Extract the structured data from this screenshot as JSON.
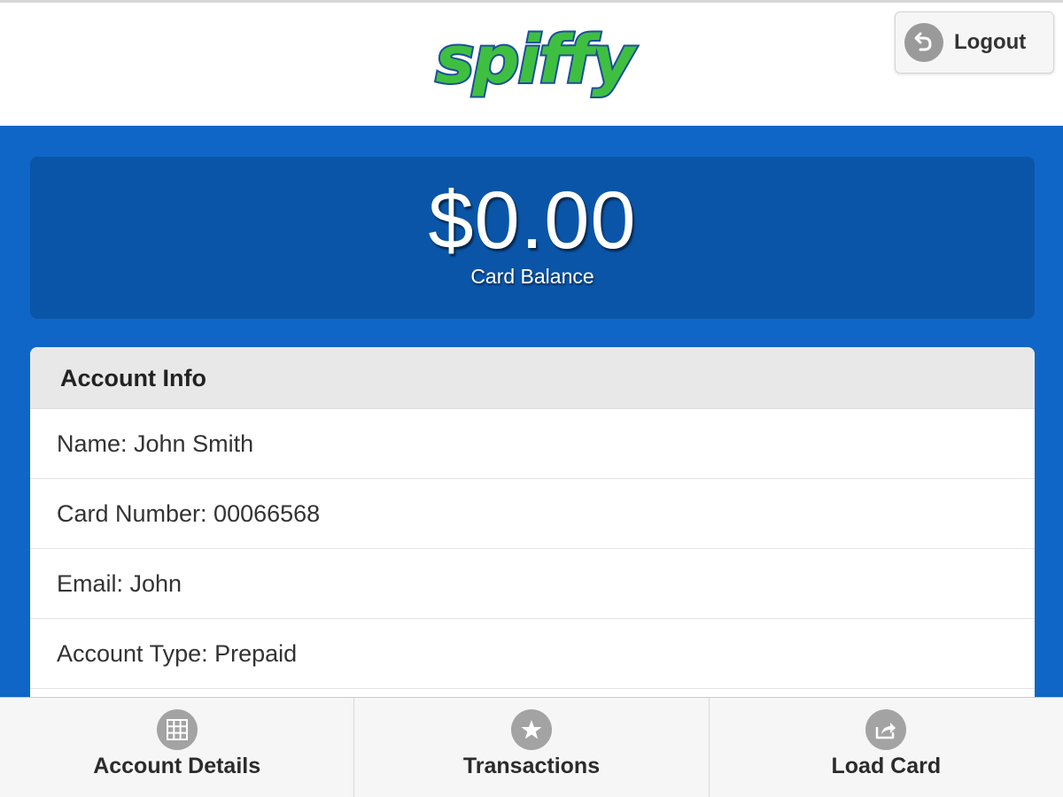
{
  "header": {
    "logo_text": "spiffy",
    "logout_label": "Logout",
    "logout_icon": "back-arrow-icon"
  },
  "balance": {
    "amount": "$0.00",
    "label": "Card Balance"
  },
  "account_info": {
    "title": "Account Info",
    "rows": [
      "Name: John Smith",
      "Card Number: 00066568",
      "Email: John",
      "Account Type: Prepaid"
    ]
  },
  "bottom_nav": [
    {
      "label": "Account Details",
      "icon": "grid-icon"
    },
    {
      "label": "Transactions",
      "icon": "star-icon"
    },
    {
      "label": "Load Card",
      "icon": "share-icon"
    }
  ],
  "colors": {
    "primary_blue": "#0f66c7",
    "balance_box": "#0b55a8",
    "logo_green": "#3fbf3f",
    "logo_outline": "#1b4f9c"
  }
}
